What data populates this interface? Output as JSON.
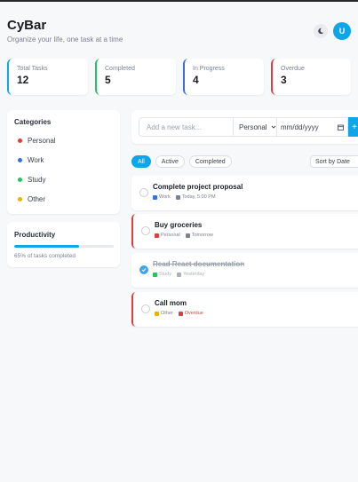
{
  "header": {
    "title": "CyBar",
    "subtitle": "Organize your life, one task at a time",
    "avatar_initial": "U"
  },
  "stats": [
    {
      "label": "Total Tasks",
      "value": "12",
      "accent": "#0ea5e9"
    },
    {
      "label": "Completed",
      "value": "5",
      "accent": "#22c55e"
    },
    {
      "label": "In Progress",
      "value": "4",
      "accent": "#3b6fe0"
    },
    {
      "label": "Overdue",
      "value": "3",
      "accent": "#e03e3e"
    }
  ],
  "categories": {
    "title": "Categories",
    "items": [
      {
        "label": "Personal",
        "color": "#e03e3e"
      },
      {
        "label": "Work",
        "color": "#3b6fe0"
      },
      {
        "label": "Study",
        "color": "#22c55e"
      },
      {
        "label": "Other",
        "color": "#eab308"
      }
    ]
  },
  "productivity": {
    "title": "Productivity",
    "progress": 0.65,
    "caption": "65% of tasks completed"
  },
  "add_task": {
    "placeholder": "Add a new task...",
    "category": "Personal",
    "date_placeholder": "mm/dd/yyyy",
    "add_label": "+"
  },
  "filters": [
    "All",
    "Active",
    "Completed"
  ],
  "sort_label": "Sort by Date",
  "tasks": [
    {
      "title": "Complete project proposal",
      "category": "Work",
      "date": "Today, 5:00 PM",
      "done": false,
      "flag": ""
    },
    {
      "title": "Buy groceries",
      "category": "Personal",
      "date": "Tomorrow",
      "done": false,
      "flag": "red"
    },
    {
      "title": "Read React documentation",
      "category": "Study",
      "date": "Yesterday",
      "done": true,
      "flag": ""
    },
    {
      "title": "Call mom",
      "category": "Other",
      "date": "Overdue",
      "done": false,
      "flag": "red"
    }
  ],
  "colors": {
    "accent": "#0ea5e9",
    "danger": "#e03e3e"
  }
}
